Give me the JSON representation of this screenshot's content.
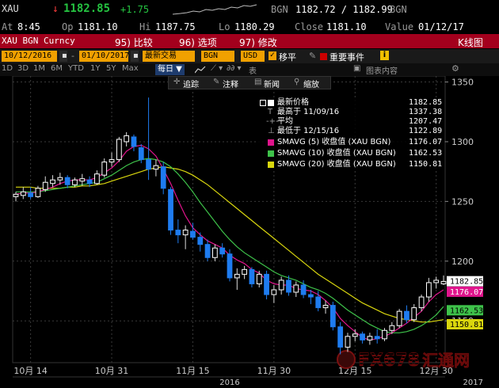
{
  "header": {
    "ticker": "XAU",
    "arrow": "↓",
    "last": "1182.85",
    "change": "+1.75",
    "source": "BGN",
    "bid_ask": "1182.72 / 1182.99",
    "source2": "BGN"
  },
  "quote": {
    "at_label": "At",
    "at_value": "8:45",
    "op_label": "Op",
    "op_value": "1181.10",
    "hi_label": "Hi",
    "hi_value": "1187.75",
    "lo_label": "Lo",
    "lo_value": "1180.29",
    "close_label": "Close",
    "close_value": "1181.10",
    "value_label": "Value",
    "value_value": "01/12/17"
  },
  "menubar": {
    "security": "XAU BGN Curncy",
    "items": [
      "95) 比较",
      "96) 选项",
      "97) 修改"
    ],
    "right": "K线图"
  },
  "settings": {
    "date_from": "10/12/2016",
    "date_to": "01/10/2017",
    "dash": "-",
    "mode": "最新交易",
    "source": "BGN",
    "currency": "USD",
    "smooth": "移平",
    "events": "重要事件"
  },
  "toolbar": {
    "periods": [
      "1D",
      "3D",
      "1M",
      "6M",
      "YTD",
      "1Y",
      "5Y",
      "Max"
    ],
    "frequency": "每日",
    "table_label": "表",
    "chart_content": "图表内容",
    "gear": "⚙"
  },
  "popup": {
    "items": [
      "追踪",
      "注释",
      "新闻",
      "缩放"
    ]
  },
  "legend": {
    "items": [
      {
        "label": "最新价格",
        "value": "1182.85"
      },
      {
        "label": "最高于 11/09/16",
        "value": "1337.38"
      },
      {
        "label": "平均",
        "value": "1207.47"
      },
      {
        "label": "最低于 12/15/16",
        "value": "1122.89"
      },
      {
        "label": "SMAVG (5) 收盘值 (XAU BGN)",
        "value": "1176.07"
      },
      {
        "label": "SMAVG (10) 收盘值 (XAU BGN)",
        "value": "1162.53"
      },
      {
        "label": "SMAVG (20) 收盘值 (XAU BGN)",
        "value": "1150.81"
      }
    ]
  },
  "watermark": {
    "text": "FX678",
    "cn": "汇通网"
  },
  "colors": {
    "up": "#ffffff",
    "down": "#1e7cf0",
    "sma5": "#e0148c",
    "sma10": "#3ec24a",
    "sma20": "#d9d60e",
    "last_tag": "#ffffff"
  },
  "chart_data": {
    "type": "candlestick",
    "ylim": [
      1115,
      1355
    ],
    "yticks": [
      1150,
      1200,
      1250,
      1300,
      1350
    ],
    "xtick_labels": [
      {
        "label": "10月 14",
        "i": 2
      },
      {
        "label": "10月 31",
        "i": 13
      },
      {
        "label": "11月 15",
        "i": 24
      },
      {
        "label": "11月 30",
        "i": 35
      },
      {
        "label": "12月 15",
        "i": 46
      },
      {
        "label": "12月 30",
        "i": 57
      }
    ],
    "year_labels": [
      {
        "label": "2016",
        "i": 29
      },
      {
        "label": "2017",
        "i": 62
      }
    ],
    "candles": [
      {
        "o": 1254,
        "h": 1258,
        "l": 1250,
        "c": 1256
      },
      {
        "o": 1255,
        "h": 1262,
        "l": 1252,
        "c": 1258
      },
      {
        "o": 1257,
        "h": 1262,
        "l": 1252,
        "c": 1254
      },
      {
        "o": 1254,
        "h": 1263,
        "l": 1253,
        "c": 1261
      },
      {
        "o": 1260,
        "h": 1271,
        "l": 1258,
        "c": 1266
      },
      {
        "o": 1265,
        "h": 1272,
        "l": 1262,
        "c": 1268
      },
      {
        "o": 1268,
        "h": 1274,
        "l": 1264,
        "c": 1270
      },
      {
        "o": 1270,
        "h": 1272,
        "l": 1261,
        "c": 1264
      },
      {
        "o": 1264,
        "h": 1270,
        "l": 1262,
        "c": 1268
      },
      {
        "o": 1267,
        "h": 1273,
        "l": 1263,
        "c": 1269
      },
      {
        "o": 1268,
        "h": 1271,
        "l": 1262,
        "c": 1265
      },
      {
        "o": 1265,
        "h": 1276,
        "l": 1264,
        "c": 1273
      },
      {
        "o": 1272,
        "h": 1286,
        "l": 1270,
        "c": 1283
      },
      {
        "o": 1283,
        "h": 1291,
        "l": 1279,
        "c": 1285
      },
      {
        "o": 1285,
        "h": 1304,
        "l": 1283,
        "c": 1302
      },
      {
        "o": 1300,
        "h": 1308,
        "l": 1296,
        "c": 1305
      },
      {
        "o": 1304,
        "h": 1306,
        "l": 1292,
        "c": 1296
      },
      {
        "o": 1295,
        "h": 1298,
        "l": 1282,
        "c": 1285
      },
      {
        "o": 1285,
        "h": 1337,
        "l": 1268,
        "c": 1277
      },
      {
        "o": 1277,
        "h": 1285,
        "l": 1271,
        "c": 1280
      },
      {
        "o": 1279,
        "h": 1283,
        "l": 1256,
        "c": 1261
      },
      {
        "o": 1260,
        "h": 1262,
        "l": 1222,
        "c": 1226
      },
      {
        "o": 1226,
        "h": 1235,
        "l": 1215,
        "c": 1222
      },
      {
        "o": 1222,
        "h": 1230,
        "l": 1210,
        "c": 1226
      },
      {
        "o": 1225,
        "h": 1232,
        "l": 1218,
        "c": 1220
      },
      {
        "o": 1220,
        "h": 1224,
        "l": 1208,
        "c": 1214
      },
      {
        "o": 1214,
        "h": 1218,
        "l": 1200,
        "c": 1203
      },
      {
        "o": 1203,
        "h": 1214,
        "l": 1200,
        "c": 1211
      },
      {
        "o": 1211,
        "h": 1215,
        "l": 1203,
        "c": 1206
      },
      {
        "o": 1206,
        "h": 1210,
        "l": 1183,
        "c": 1186
      },
      {
        "o": 1186,
        "h": 1194,
        "l": 1176,
        "c": 1189
      },
      {
        "o": 1189,
        "h": 1196,
        "l": 1185,
        "c": 1193
      },
      {
        "o": 1193,
        "h": 1195,
        "l": 1178,
        "c": 1181
      },
      {
        "o": 1181,
        "h": 1192,
        "l": 1178,
        "c": 1189
      },
      {
        "o": 1189,
        "h": 1192,
        "l": 1168,
        "c": 1172
      },
      {
        "o": 1172,
        "h": 1180,
        "l": 1165,
        "c": 1176
      },
      {
        "o": 1176,
        "h": 1187,
        "l": 1172,
        "c": 1184
      },
      {
        "o": 1184,
        "h": 1188,
        "l": 1171,
        "c": 1174
      },
      {
        "o": 1174,
        "h": 1183,
        "l": 1170,
        "c": 1180
      },
      {
        "o": 1180,
        "h": 1184,
        "l": 1169,
        "c": 1172
      },
      {
        "o": 1172,
        "h": 1176,
        "l": 1164,
        "c": 1170
      },
      {
        "o": 1170,
        "h": 1175,
        "l": 1158,
        "c": 1161
      },
      {
        "o": 1161,
        "h": 1167,
        "l": 1156,
        "c": 1163
      },
      {
        "o": 1163,
        "h": 1166,
        "l": 1142,
        "c": 1145
      },
      {
        "o": 1145,
        "h": 1149,
        "l": 1122,
        "c": 1128
      },
      {
        "o": 1128,
        "h": 1140,
        "l": 1124,
        "c": 1137
      },
      {
        "o": 1137,
        "h": 1143,
        "l": 1133,
        "c": 1139
      },
      {
        "o": 1139,
        "h": 1141,
        "l": 1131,
        "c": 1134
      },
      {
        "o": 1134,
        "h": 1140,
        "l": 1130,
        "c": 1137
      },
      {
        "o": 1137,
        "h": 1143,
        "l": 1131,
        "c": 1135
      },
      {
        "o": 1135,
        "h": 1144,
        "l": 1133,
        "c": 1142
      },
      {
        "o": 1142,
        "h": 1149,
        "l": 1139,
        "c": 1146
      },
      {
        "o": 1146,
        "h": 1160,
        "l": 1144,
        "c": 1158
      },
      {
        "o": 1158,
        "h": 1163,
        "l": 1148,
        "c": 1151
      },
      {
        "o": 1151,
        "h": 1164,
        "l": 1149,
        "c": 1161
      },
      {
        "o": 1161,
        "h": 1172,
        "l": 1158,
        "c": 1170
      },
      {
        "o": 1170,
        "h": 1186,
        "l": 1166,
        "c": 1182
      },
      {
        "o": 1182,
        "h": 1187,
        "l": 1177,
        "c": 1184
      },
      {
        "o": 1181,
        "h": 1188,
        "l": 1180,
        "c": 1183
      }
    ],
    "sma5": [
      1256,
      1257,
      1257,
      1258,
      1260,
      1262,
      1265,
      1267,
      1268,
      1268,
      1268,
      1270,
      1274,
      1278,
      1284,
      1292,
      1296,
      1297,
      1294,
      1288,
      1277,
      1265,
      1251,
      1238,
      1228,
      1222,
      1217,
      1214,
      1211,
      1205,
      1201,
      1198,
      1193,
      1190,
      1184,
      1181,
      1180,
      1180,
      1177,
      1176,
      1175,
      1172,
      1167,
      1161,
      1152,
      1146,
      1141,
      1136,
      1134,
      1135,
      1137,
      1140,
      1144,
      1148,
      1153,
      1158,
      1166,
      1172,
      1176
    ],
    "sma10": [
      1258,
      1258,
      1258,
      1258,
      1259,
      1260,
      1261,
      1262,
      1263,
      1264,
      1265,
      1266,
      1269,
      1272,
      1276,
      1280,
      1283,
      1285,
      1286,
      1285,
      1283,
      1279,
      1273,
      1266,
      1258,
      1249,
      1241,
      1233,
      1225,
      1218,
      1212,
      1207,
      1203,
      1199,
      1195,
      1191,
      1188,
      1186,
      1184,
      1181,
      1178,
      1176,
      1173,
      1169,
      1164,
      1159,
      1155,
      1151,
      1147,
      1144,
      1141,
      1140,
      1140,
      1141,
      1143,
      1146,
      1150,
      1155,
      1162
    ],
    "sma20": [
      1262,
      1262,
      1262,
      1261,
      1261,
      1261,
      1261,
      1262,
      1262,
      1263,
      1263,
      1264,
      1265,
      1267,
      1269,
      1271,
      1273,
      1275,
      1277,
      1278,
      1279,
      1278,
      1277,
      1275,
      1272,
      1268,
      1264,
      1259,
      1254,
      1249,
      1244,
      1239,
      1234,
      1229,
      1224,
      1219,
      1214,
      1209,
      1204,
      1199,
      1194,
      1189,
      1185,
      1181,
      1177,
      1173,
      1169,
      1165,
      1162,
      1159,
      1156,
      1154,
      1152,
      1151,
      1150,
      1149,
      1149,
      1150,
      1151
    ]
  }
}
